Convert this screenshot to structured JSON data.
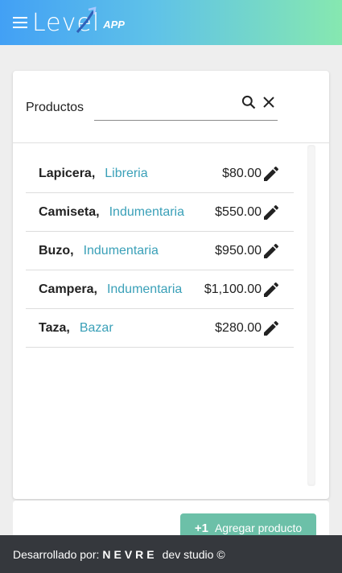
{
  "header": {
    "menu_icon": "menu-icon",
    "logo_text": "Level",
    "logo_sub": "APP"
  },
  "products_card": {
    "title": "Productos",
    "search": {
      "value": "",
      "placeholder": ""
    },
    "search_icon": "search-icon",
    "clear_icon": "close-icon",
    "items": [
      {
        "name": "Lapicera",
        "category": "Libreria",
        "price": "$80.00"
      },
      {
        "name": "Camiseta",
        "category": "Indumentaria",
        "price": "$550.00"
      },
      {
        "name": "Buzo",
        "category": "Indumentaria",
        "price": "$950.00"
      },
      {
        "name": "Campera",
        "category": "Indumentaria",
        "price": "$1,100.00"
      },
      {
        "name": "Taza",
        "category": "Bazar",
        "price": "$280.00"
      }
    ],
    "item_separator": ",",
    "edit_icon": "pencil-icon"
  },
  "actions": {
    "add_icon_text": "+1",
    "add_label": "Agregar producto"
  },
  "footer": {
    "prefix": "Desarrollado por:",
    "brand": "NEVRE",
    "suffix": "dev studio ©"
  },
  "colors": {
    "accent_category": "#3aa0b8",
    "add_button": "#6cc0a8",
    "footer_bg": "#35383d"
  }
}
